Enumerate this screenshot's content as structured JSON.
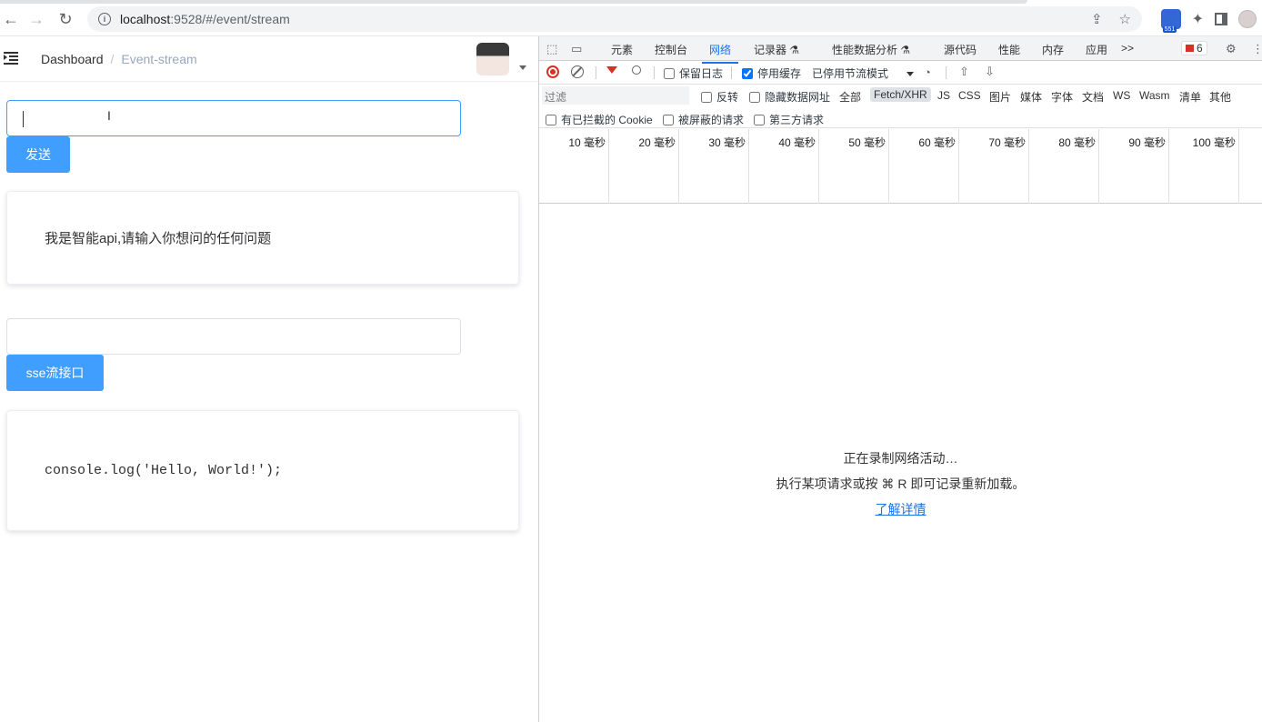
{
  "browser": {
    "url_host": "localhost",
    "url_rest": ":9528/#/event/stream",
    "extension_badge": "551"
  },
  "app": {
    "breadcrumb": {
      "root": "Dashboard",
      "separator": "/",
      "current": "Event-stream"
    },
    "input1": {
      "value": "",
      "placeholder": ""
    },
    "send_button": "发送",
    "card1_text": "我是智能api,请输入你想问的任何问题",
    "input2": {
      "value": "",
      "placeholder": ""
    },
    "sse_button": "sse流接口",
    "card2_code": "console.log('Hello, World!');"
  },
  "devtools": {
    "tabs": [
      "元素",
      "控制台",
      "网络",
      "记录器 ⚗",
      "性能数据分析 ⚗",
      "源代码",
      "性能",
      "内存",
      "应用"
    ],
    "active_tab": "网络",
    "more": ">>",
    "error_count": "6",
    "toolbar": {
      "preserve_log": "保留日志",
      "disable_cache": "停用缓存",
      "throttle": "已停用节流模式"
    },
    "filter": {
      "placeholder": "过滤",
      "invert": "反转",
      "hide_data_urls": "隐藏数据网址",
      "types": [
        "全部",
        "Fetch/XHR",
        "JS",
        "CSS",
        "图片",
        "媒体",
        "字体",
        "文档",
        "WS",
        "Wasm",
        "清单",
        "其他"
      ],
      "selected_type": "Fetch/XHR",
      "blocked_cookies": "有已拦截的 Cookie",
      "blocked_requests": "被屏蔽的请求",
      "third_party": "第三方请求"
    },
    "timeline_ticks": [
      "10 毫秒",
      "20 毫秒",
      "30 毫秒",
      "40 毫秒",
      "50 毫秒",
      "60 毫秒",
      "70 毫秒",
      "80 毫秒",
      "90 毫秒",
      "100 毫秒"
    ],
    "empty": {
      "line1": "正在录制网络活动…",
      "line2": "执行某项请求或按 ⌘ R 即可记录重新加载。",
      "link": "了解详情"
    }
  }
}
